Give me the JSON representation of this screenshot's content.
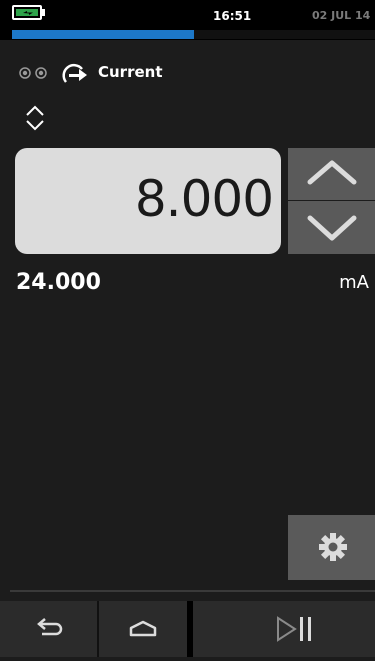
{
  "status": {
    "time": "16:51",
    "date": "02 JUL 14",
    "battery_state": "charging",
    "progress_fraction": 0.5
  },
  "channel": {
    "label": "Current"
  },
  "output": {
    "value": "8.000",
    "range_value": "24.000",
    "unit": "mA"
  },
  "colors": {
    "progress": "#1d78c8",
    "battery": "#2ea34a",
    "value_box": "#dcdcdc",
    "button": "#5a5a5a"
  },
  "icons": {
    "battery": "battery-charging-icon",
    "channel": "dual-dot-icon",
    "source": "source-arrow-icon",
    "updown": "up-down-chevron-icon",
    "step_up": "chevron-up-icon",
    "step_down": "chevron-down-icon",
    "settings": "gear-icon",
    "back": "back-arrow-icon",
    "home": "home-icon",
    "play_pause": "play-pause-icon"
  }
}
